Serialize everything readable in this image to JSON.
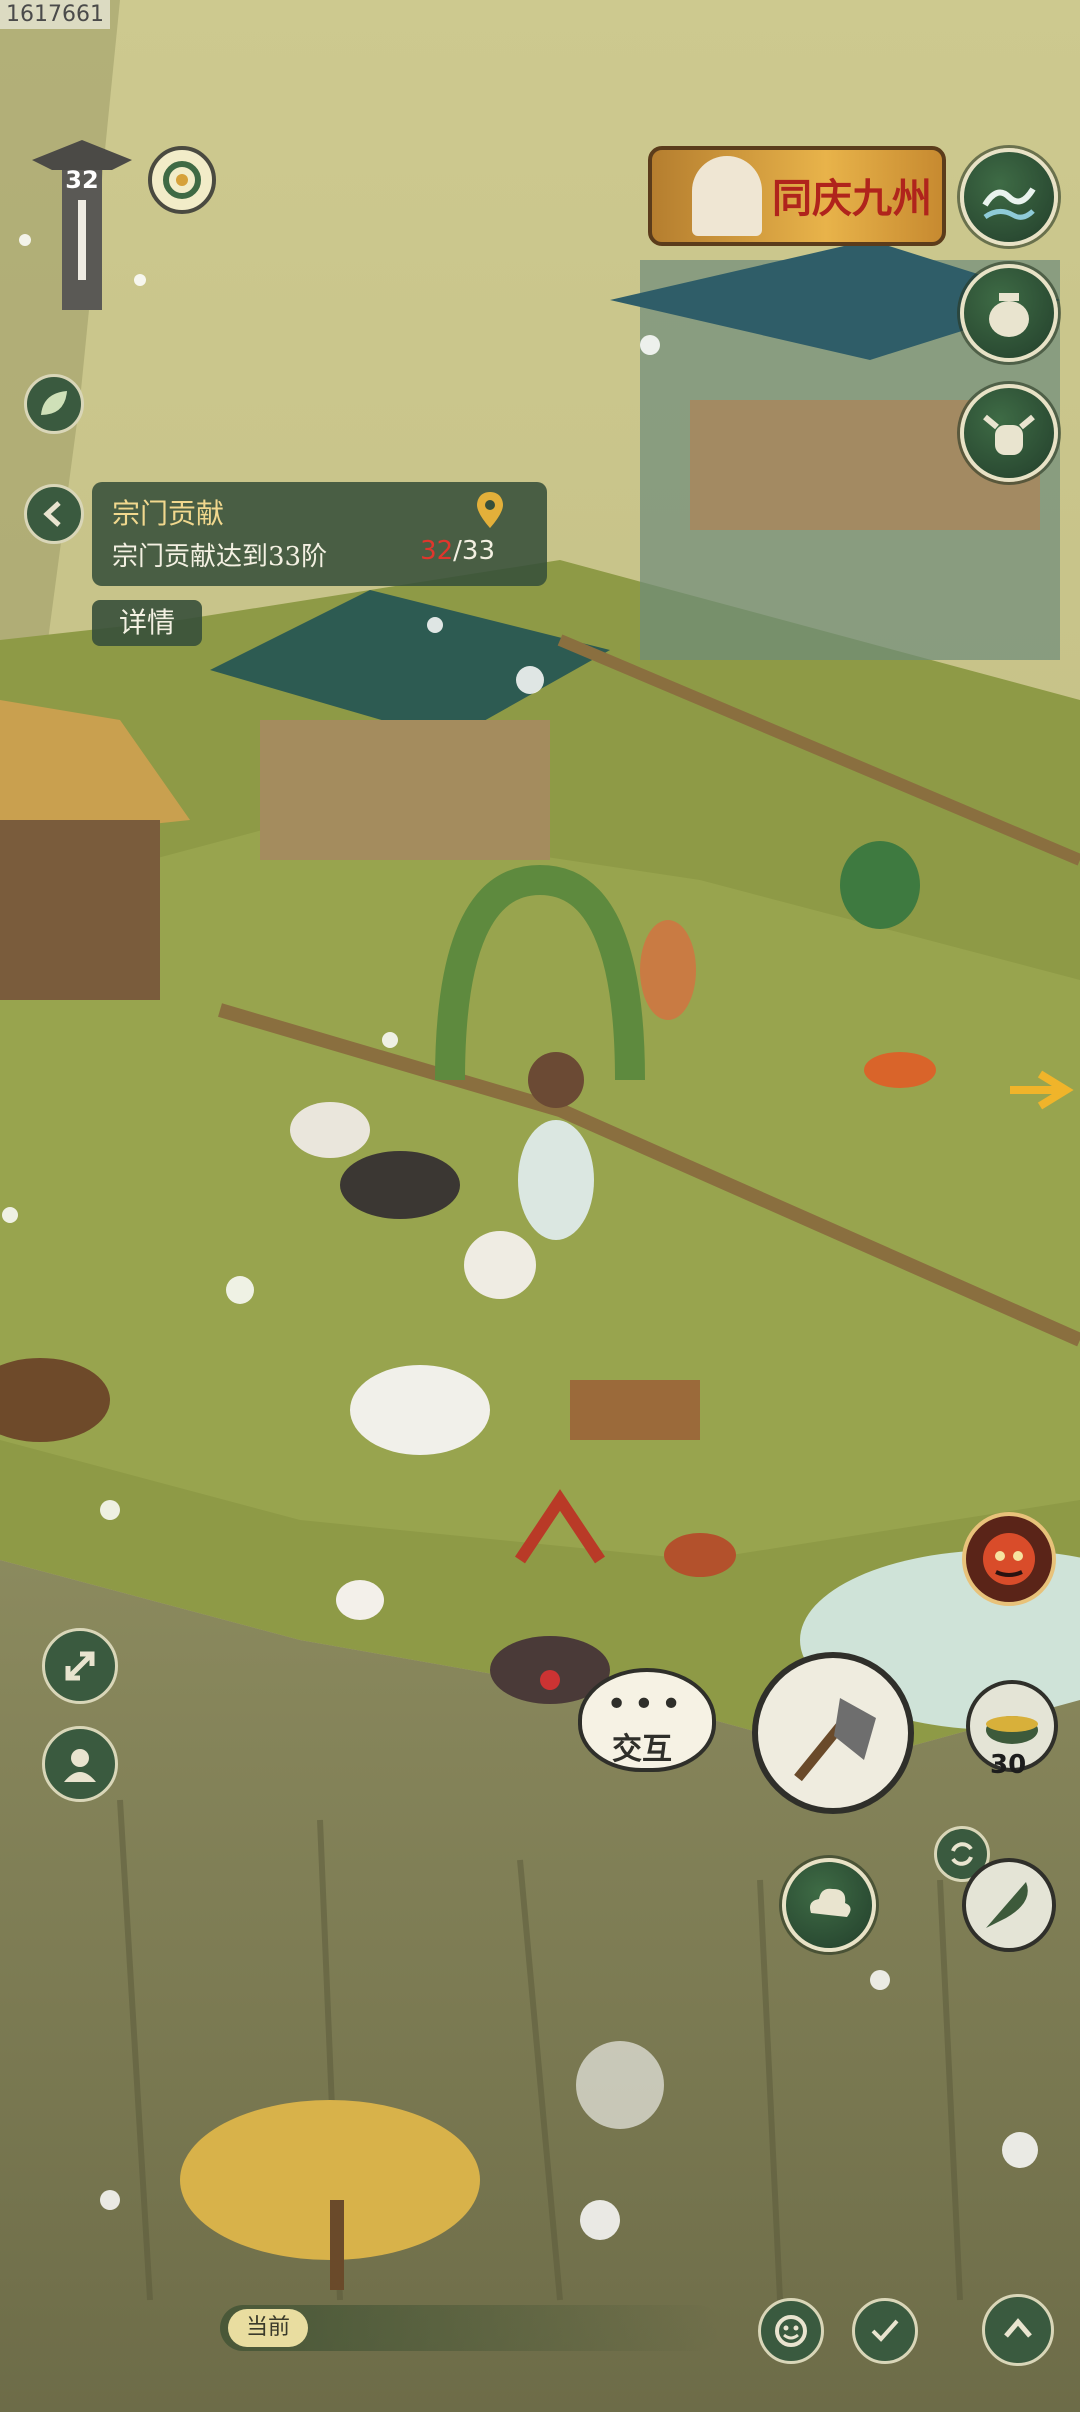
{
  "corner_id": "1617661",
  "player": {
    "level": "32"
  },
  "event_banner": {
    "text": "同庆九州"
  },
  "quest": {
    "title": "宗门贡献",
    "description": "宗门贡献达到33阶",
    "progress_current": "32",
    "progress_total": "/33",
    "detail_label": "详情"
  },
  "interact": {
    "dots": "•••",
    "label": "交互"
  },
  "axe_tool": {
    "count": "30"
  },
  "bottom_bar": {
    "current_label": "当前"
  },
  "icons": [
    "pagoda-level-icon",
    "compass-icon",
    "leaf-icon",
    "back-arrow-icon",
    "wave-icon",
    "jar-icon",
    "ox-mask-icon",
    "expand-icon",
    "person-icon",
    "demon-face-icon",
    "axe-icon",
    "pot-icon",
    "swap-icon",
    "cloud-icon",
    "feather-brush-icon",
    "smile-icon",
    "check-brush-icon",
    "chevron-up-icon"
  ],
  "colors": {
    "panel_bg": "#37503a",
    "quest_title": "#f1d88e",
    "progress_highlight": "#e0362c"
  }
}
